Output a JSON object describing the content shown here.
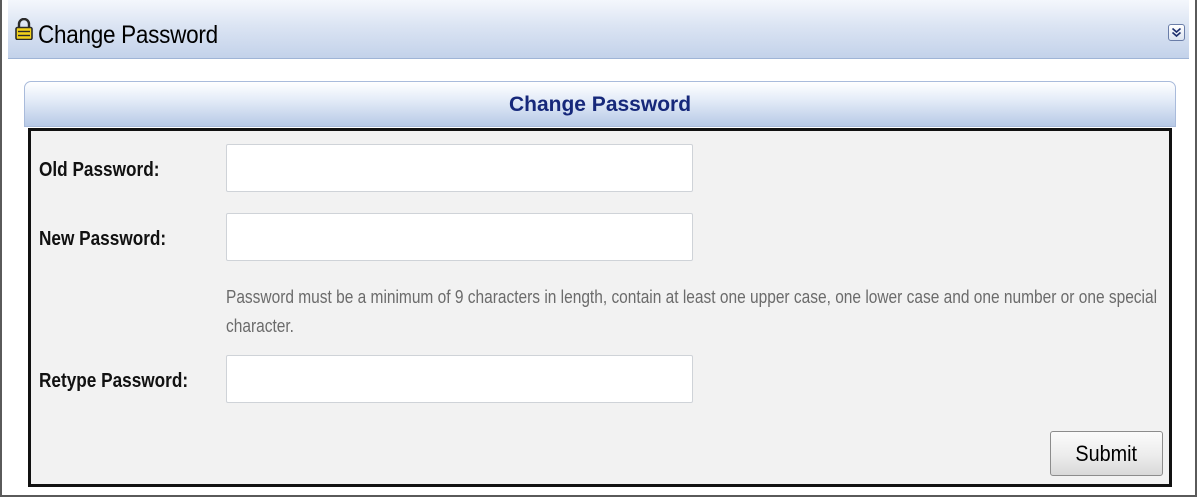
{
  "window": {
    "title": "Change Password",
    "icon": "lock-icon",
    "collapse_icon": "collapse-icon",
    "accent_color": "#16287a"
  },
  "panel": {
    "title": "Change Password"
  },
  "form": {
    "old_password": {
      "label": "Old Password:",
      "value": "",
      "placeholder": ""
    },
    "new_password": {
      "label": "New Password:",
      "value": "",
      "placeholder": ""
    },
    "hint": "Password must be a minimum of 9 characters in length, contain at least one upper case, one lower case and one number or one special character.",
    "retype_password": {
      "label": "Retype Password:",
      "value": "",
      "placeholder": ""
    },
    "submit_label": "Submit"
  }
}
